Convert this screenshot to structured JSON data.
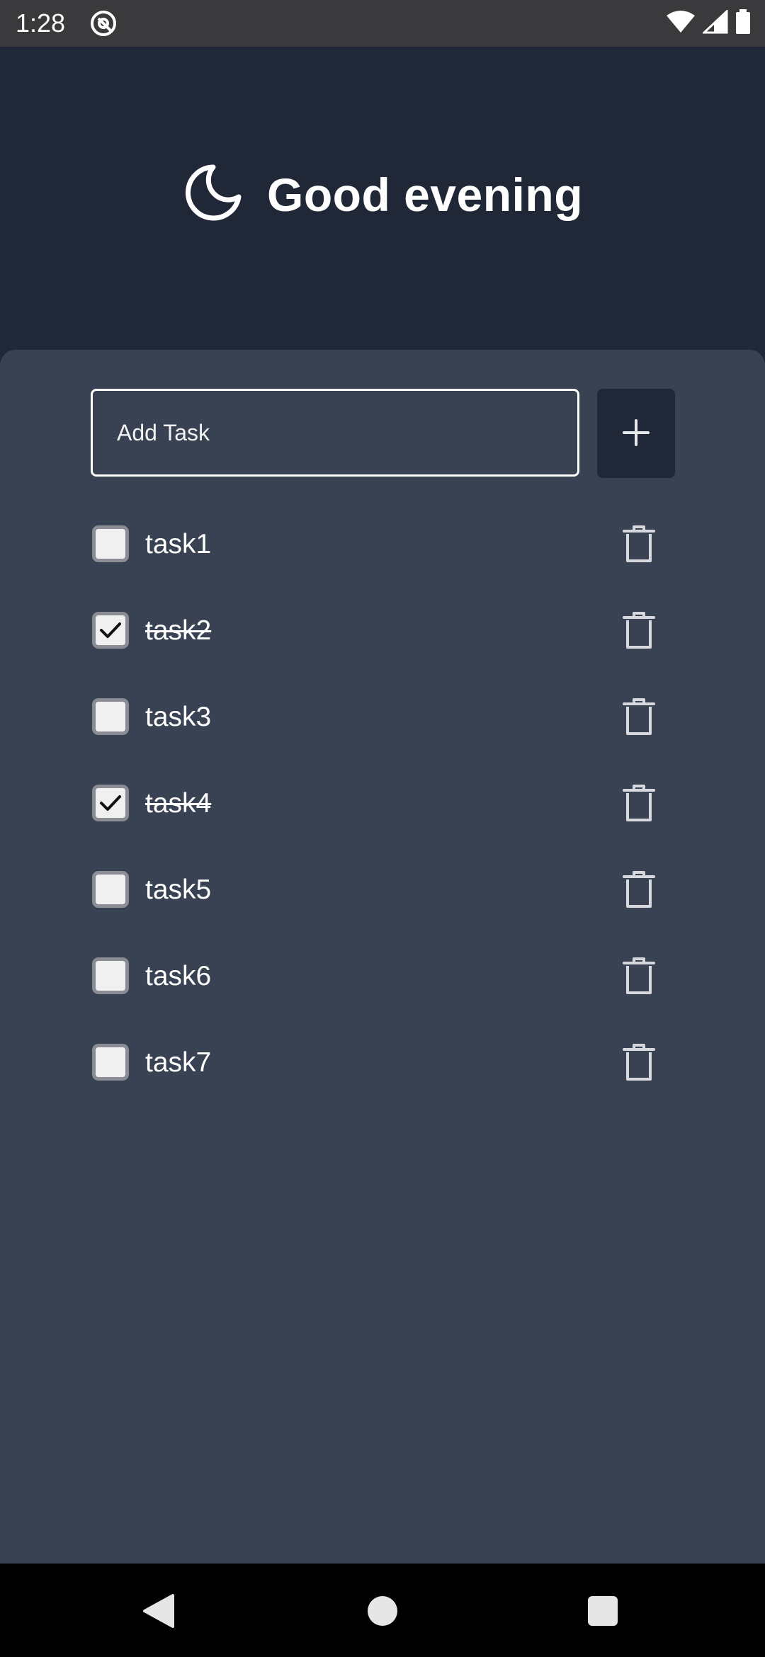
{
  "status_bar": {
    "time": "1:28",
    "icons": [
      "app-notification-icon",
      "wifi-icon",
      "signal-icon",
      "battery-icon"
    ]
  },
  "header": {
    "greeting": "Good evening",
    "icon": "moon-icon"
  },
  "task_input": {
    "placeholder": "Add Task",
    "value": ""
  },
  "add_button": {
    "icon": "plus-icon"
  },
  "tasks": [
    {
      "label": "task1",
      "done": false
    },
    {
      "label": "task2",
      "done": true
    },
    {
      "label": "task3",
      "done": false
    },
    {
      "label": "task4",
      "done": true
    },
    {
      "label": "task5",
      "done": false
    },
    {
      "label": "task6",
      "done": false
    },
    {
      "label": "task7",
      "done": false
    }
  ],
  "colors": {
    "header_bg": "#202837",
    "panel_bg": "#394253",
    "status_bar_bg": "#3a3a3c",
    "text": "#ffffff",
    "icon_muted": "#d6d8dd"
  },
  "nav_bar": {
    "buttons": [
      "back-icon",
      "home-icon",
      "recents-icon"
    ]
  }
}
